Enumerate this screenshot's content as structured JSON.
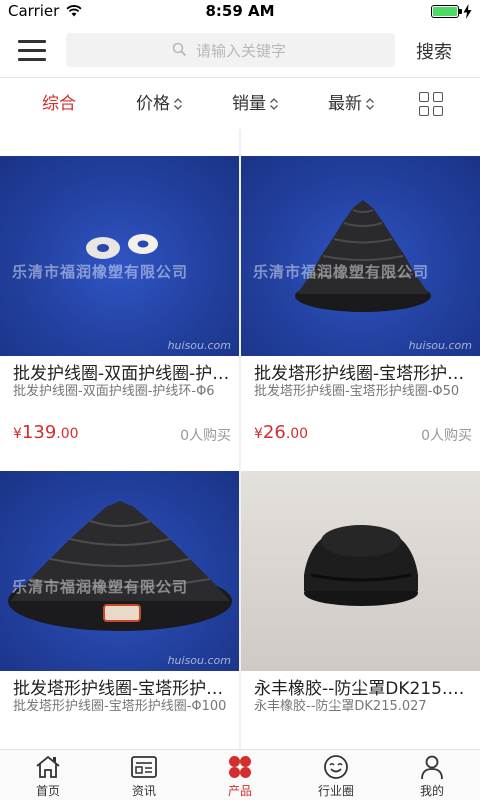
{
  "status_bar": {
    "carrier": "Carrier",
    "time": "8:59 AM"
  },
  "header": {
    "search_placeholder": "请输入关键字",
    "search_button": "搜索"
  },
  "filters": {
    "items": [
      {
        "label": "综合",
        "active": true,
        "sortable": false
      },
      {
        "label": "价格",
        "active": false,
        "sortable": true
      },
      {
        "label": "销量",
        "active": false,
        "sortable": true
      },
      {
        "label": "最新",
        "active": false,
        "sortable": true
      }
    ],
    "accent_color": "#d32f2f"
  },
  "products": [
    {
      "title": "批发护线圈-双面护线圈-护线环-Φ6",
      "desc": "批发护线圈-双面护线圈-护线环-Φ6",
      "currency": "¥",
      "price_int": "139",
      "price_dec": ".00",
      "sales": "0人购买",
      "watermark": "乐清市福润橡塑有限公司",
      "image_mark": "huisou.com"
    },
    {
      "title": "批发塔形护线圈-宝塔形护线圈-Φ50",
      "desc": "批发塔形护线圈-宝塔形护线圈-Φ50",
      "currency": "¥",
      "price_int": "26",
      "price_dec": ".00",
      "sales": "0人购买",
      "watermark": "乐清市福润橡塑有限公司",
      "image_mark": "huisou.com"
    },
    {
      "title": "批发塔形护线圈-宝塔形护线圈-Φ100",
      "desc": "批发塔形护线圈-宝塔形护线圈-Φ100",
      "currency": "",
      "price_int": "",
      "price_dec": "",
      "sales": "",
      "watermark": "乐清市福润橡塑有限公司",
      "image_mark": "huisou.com"
    },
    {
      "title": "永丰橡胶--防尘罩DK215.027",
      "desc": "永丰橡胶--防尘罩DK215.027",
      "currency": "",
      "price_int": "",
      "price_dec": "",
      "sales": "",
      "watermark": "",
      "image_mark": ""
    }
  ],
  "tab_bar": {
    "items": [
      {
        "label": "首页",
        "icon": "home-icon",
        "active": false
      },
      {
        "label": "资讯",
        "icon": "news-icon",
        "active": false
      },
      {
        "label": "产品",
        "icon": "product-icon",
        "active": true
      },
      {
        "label": "行业圈",
        "icon": "industry-circle-icon",
        "active": false
      },
      {
        "label": "我的",
        "icon": "profile-icon",
        "active": false
      }
    ]
  }
}
